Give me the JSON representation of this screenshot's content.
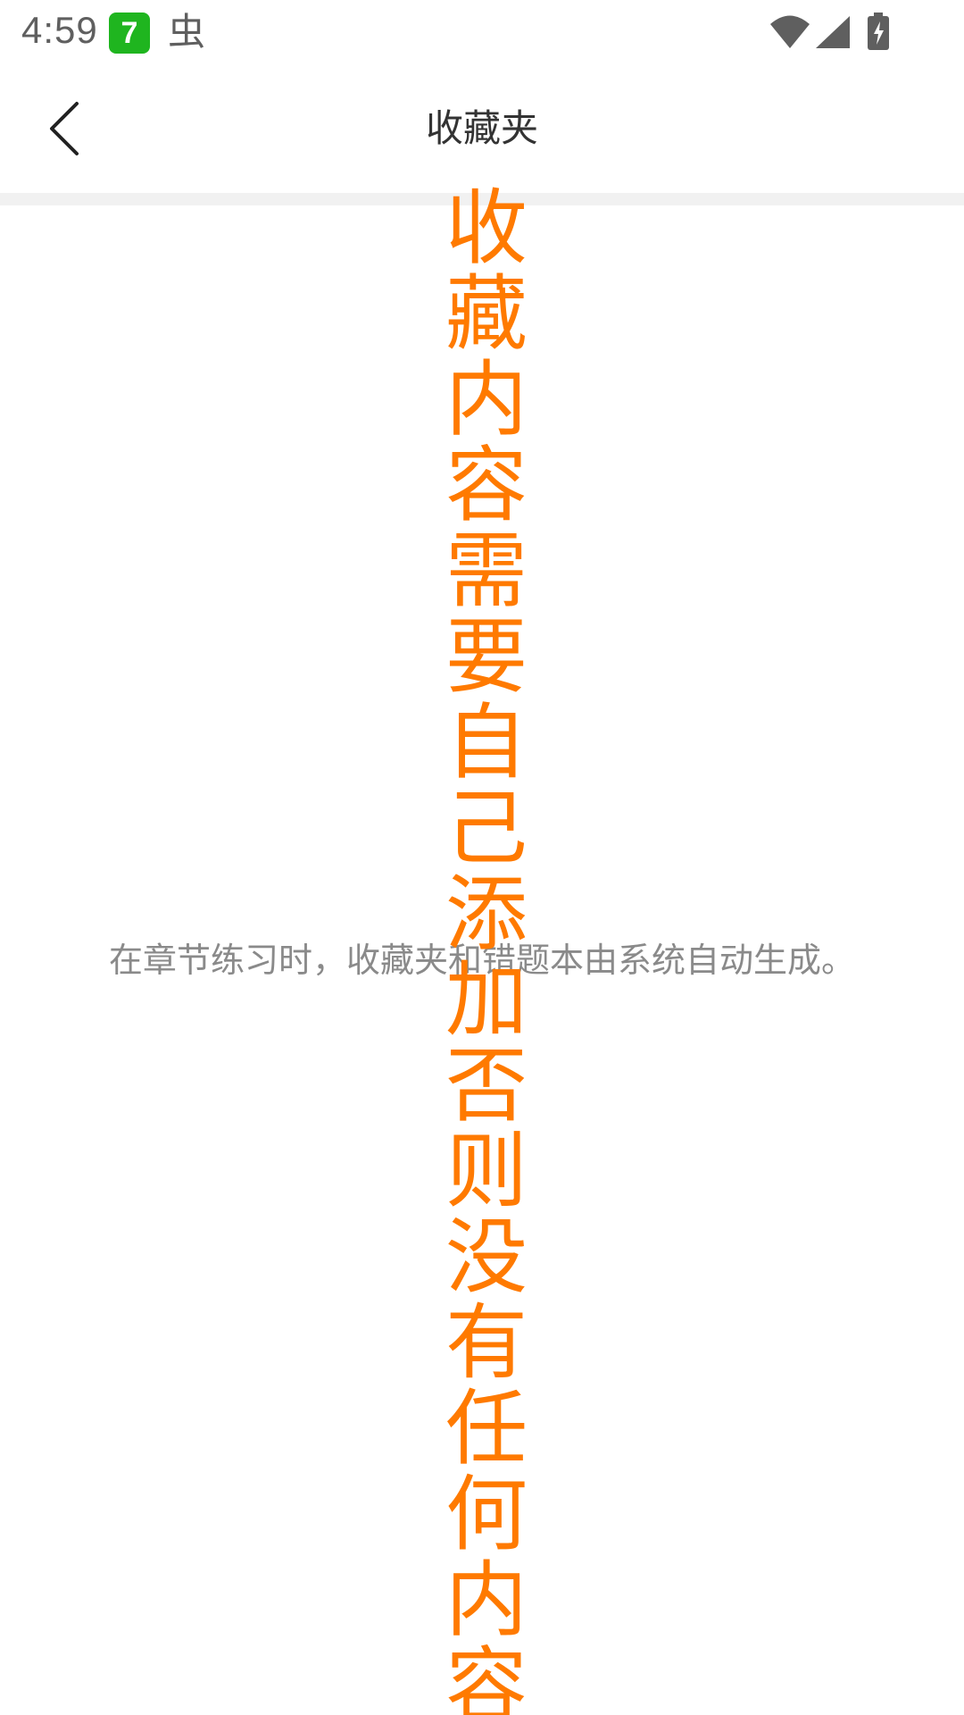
{
  "status_bar": {
    "time": "4:59",
    "app_badge": "7",
    "bug_glyph": "虫",
    "icons": [
      "wifi-icon",
      "signal-icon",
      "battery-charging-icon"
    ]
  },
  "header": {
    "title": "收藏夹",
    "back_icon": "chevron-left-icon"
  },
  "main": {
    "empty_message": "在章节练习时，收藏夹和错题本由系统自动生成。"
  },
  "overlay": {
    "text": "收藏内容需要自己添加否则没有任何内容",
    "color": "#ff7a00"
  }
}
